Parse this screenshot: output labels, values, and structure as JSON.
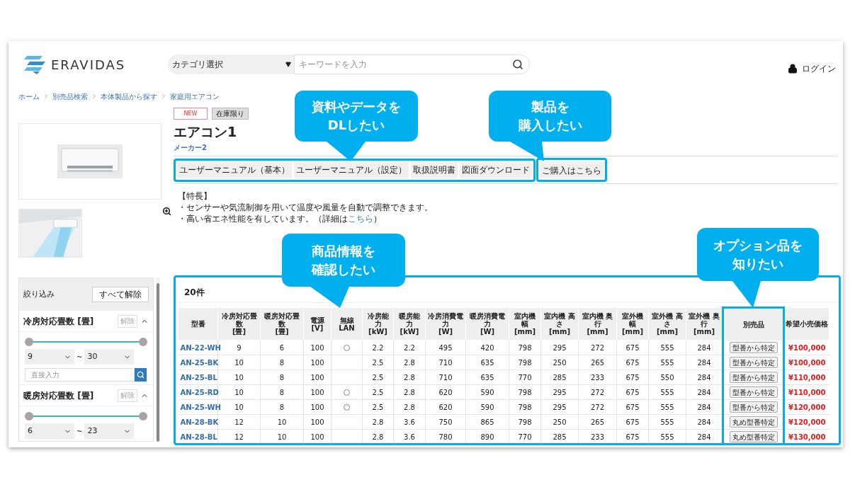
{
  "header": {
    "logo": "ERAVIDAS",
    "category_select": "カテゴリ選択",
    "search": {
      "placeholder": "キーワードを入力"
    },
    "login": "ログイン"
  },
  "breadcrumb": [
    "ホーム",
    "別売品検索",
    "本体製品から探す",
    "家庭用エアコン"
  ],
  "product": {
    "badges": [
      {
        "label": "NEW",
        "kind": "new"
      },
      {
        "label": "在庫限り",
        "kind": "stock"
      }
    ],
    "title": "エアコン1",
    "maker": "メーカー2",
    "doc_buttons": [
      "ユーザーマニュアル（基本）",
      "ユーザーマニュアル（設定）",
      "取扱説明書",
      "図面ダウンロード"
    ],
    "purchase_button": "ご購入はこちら",
    "features_heading": "【特長】",
    "features": [
      {
        "text": "・センサーや気流制御を用いて温度や風量を自動で調整できます。"
      },
      {
        "text": "・高い省エネ性能を有しています。（詳細は",
        "link": "こちら",
        "after": "）"
      }
    ]
  },
  "filter": {
    "title": "絞り込み",
    "clear_all": "すべて解除",
    "groups": [
      {
        "title": "冷房対応畳数 [畳]",
        "clear": "解除",
        "expanded": true,
        "thumbs": [
          {
            "level": 0
          },
          {
            "level": 1
          }
        ],
        "from": "9",
        "separator": "~",
        "to": "30",
        "placeholder": "直接入力"
      },
      {
        "title": "暖房対応畳数 [畳]",
        "clear": "解除",
        "expanded": true,
        "thumbs": [
          {
            "level": 0
          },
          {
            "level": 1
          }
        ],
        "from": "6",
        "separator": "~",
        "to": "23"
      }
    ]
  },
  "table": {
    "count": "20件",
    "columns": [
      [
        "型番"
      ],
      [
        "冷房対応畳",
        "数",
        "[畳]"
      ],
      [
        "暖房対応畳",
        "数",
        "[畳]"
      ],
      [
        "電源",
        "[V]"
      ],
      [
        "無線",
        "LAN"
      ],
      [
        "冷房能",
        "力",
        "[kW]"
      ],
      [
        "暖房能",
        "力",
        "[kW]"
      ],
      [
        "冷房消費電",
        "力",
        "[W]"
      ],
      [
        "暖房消費電",
        "力",
        "[W]"
      ],
      [
        "室内機",
        "幅",
        "[mm]"
      ],
      [
        "室内機 高",
        "さ",
        "[mm]"
      ],
      [
        "室内機 奥",
        "行",
        "[mm]"
      ],
      [
        "室外機",
        "幅",
        "[mm]"
      ],
      [
        "室外機 高",
        "さ",
        "[mm]"
      ],
      [
        "室外機 奥",
        "行",
        "[mm]"
      ],
      [
        "別売品"
      ],
      [
        "希望小売価格"
      ]
    ],
    "rows": [
      {
        "model": "AN-22-WH",
        "values": [
          "9",
          "6",
          "100"
        ],
        "wireless": true,
        "specs": [
          "2.2",
          "2.2",
          "495",
          "420",
          "798",
          "295",
          "272",
          "675",
          "555",
          "284"
        ],
        "option": "型番から特定",
        "price": "¥100,000"
      },
      {
        "model": "AN-25-BK",
        "values": [
          "10",
          "8",
          "100"
        ],
        "wireless": false,
        "specs": [
          "2.5",
          "2.8",
          "710",
          "635",
          "798",
          "250",
          "265",
          "675",
          "555",
          "284"
        ],
        "option": "型番から特定",
        "price": "¥100,000"
      },
      {
        "model": "AN-25-BL",
        "values": [
          "10",
          "8",
          "100"
        ],
        "wireless": false,
        "specs": [
          "2.5",
          "2.8",
          "710",
          "635",
          "770",
          "285",
          "233",
          "675",
          "550",
          "284"
        ],
        "option": "型番から特定",
        "price": "¥110,000"
      },
      {
        "model": "AN-25-RD",
        "values": [
          "10",
          "8",
          "100"
        ],
        "wireless": true,
        "specs": [
          "2.5",
          "2.8",
          "620",
          "590",
          "798",
          "295",
          "272",
          "675",
          "555",
          "284"
        ],
        "option": "型番から特定",
        "price": "¥110,000"
      },
      {
        "model": "AN-25-WH",
        "values": [
          "10",
          "8",
          "100"
        ],
        "wireless": true,
        "specs": [
          "2.5",
          "2.8",
          "620",
          "590",
          "798",
          "295",
          "272",
          "675",
          "555",
          "284"
        ],
        "option": "型番から特定",
        "price": "¥120,000"
      },
      {
        "model": "AN-28-BK",
        "values": [
          "12",
          "10",
          "100"
        ],
        "wireless": false,
        "specs": [
          "2.8",
          "3.6",
          "750",
          "865",
          "798",
          "250",
          "265",
          "675",
          "555",
          "284"
        ],
        "option": "丸め型番特定",
        "price": "¥120,000"
      },
      {
        "model": "AN-28-BL",
        "values": [
          "12",
          "10",
          "100"
        ],
        "wireless": false,
        "specs": [
          "2.8",
          "3.6",
          "780",
          "890",
          "770",
          "285",
          "233",
          "675",
          "555",
          "284"
        ],
        "option": "丸め型番特定",
        "price": "¥130,000"
      }
    ]
  },
  "callouts": [
    {
      "lines": [
        "資料やデータを",
        "DLしたい"
      ]
    },
    {
      "lines": [
        "製品を",
        "購入したい"
      ]
    },
    {
      "lines": [
        "商品情報を",
        "確認したい"
      ]
    },
    {
      "lines": [
        "オプション品を",
        "知りたい"
      ]
    }
  ]
}
